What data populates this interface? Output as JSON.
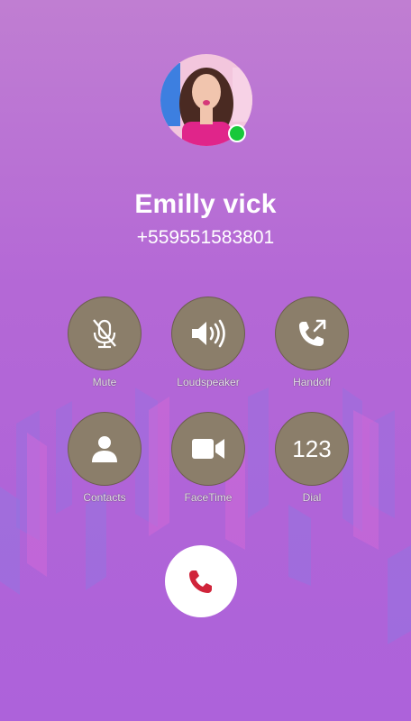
{
  "call": {
    "name": "Emilly vick",
    "number": "+559551583801",
    "status": "online"
  },
  "controls": [
    {
      "label": "Mute",
      "icon": "mic-off-icon"
    },
    {
      "label": "Loudspeaker",
      "icon": "speaker-icon"
    },
    {
      "label": "Handoff",
      "icon": "phone-forward-icon"
    },
    {
      "label": "Contacts",
      "icon": "person-icon"
    },
    {
      "label": "FaceTime",
      "icon": "video-camera-icon"
    },
    {
      "label": "Dial",
      "icon": "keypad-text",
      "text": "123"
    }
  ],
  "end_call": {
    "icon": "phone-hangup-icon",
    "color": "#d0243a"
  },
  "colors": {
    "background": "#b468d6",
    "control": "#8b7e6a",
    "online": "#18c83a"
  }
}
